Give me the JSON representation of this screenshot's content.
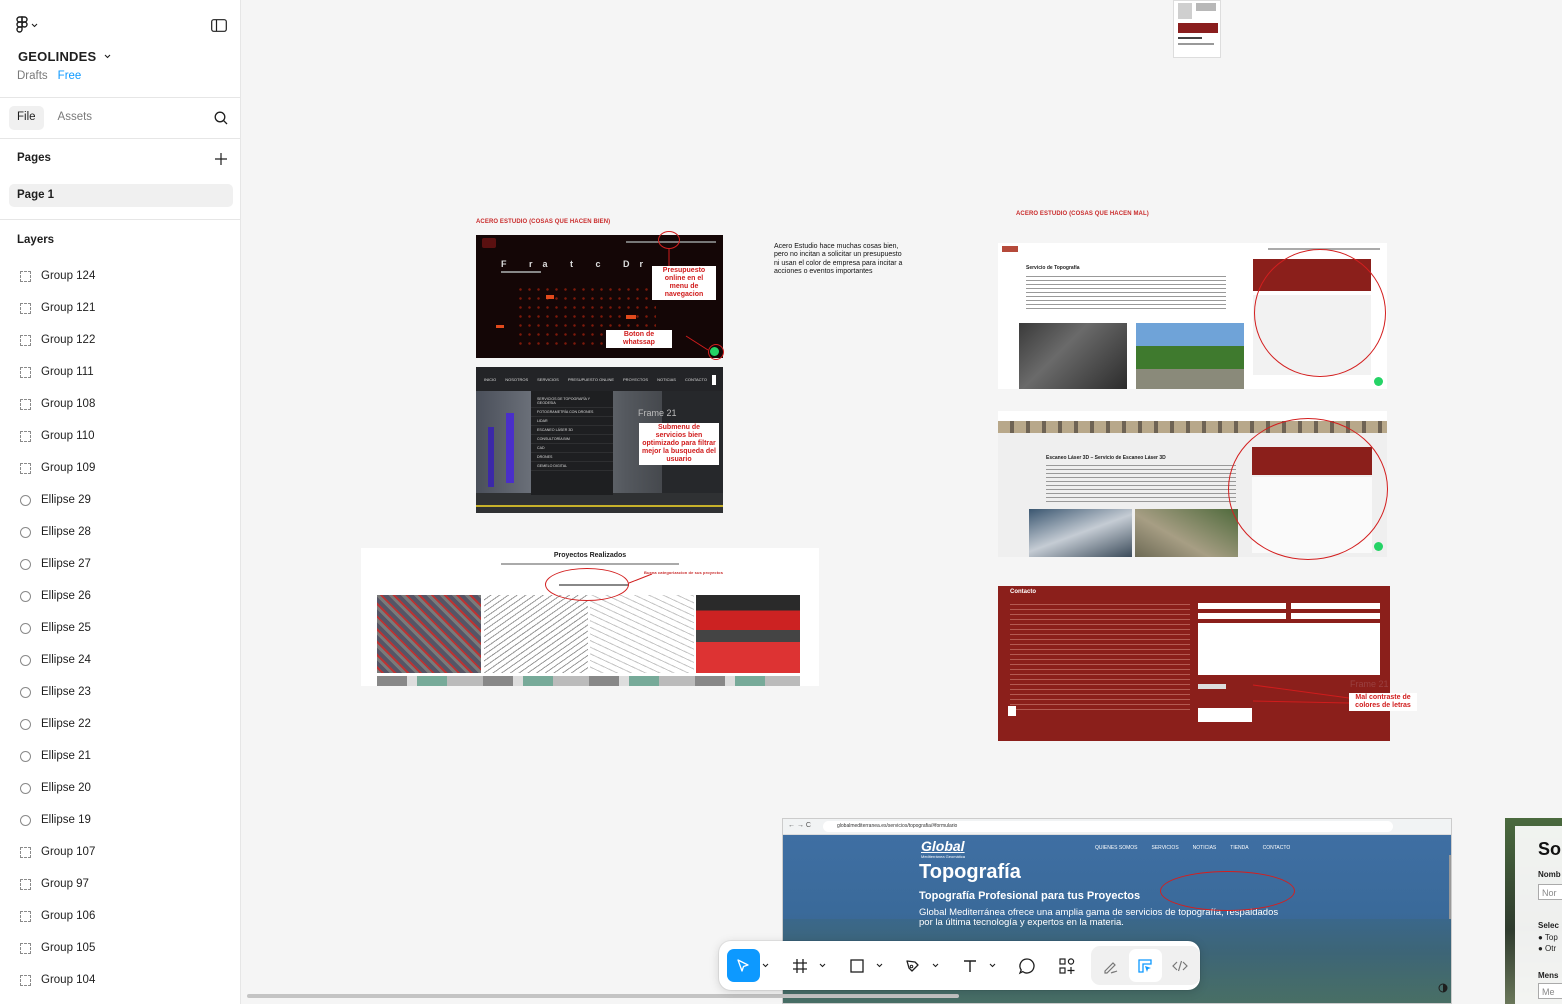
{
  "file": {
    "name": "GEOLINDES",
    "location": "Drafts",
    "plan": "Free"
  },
  "tabs": {
    "file": "File",
    "assets": "Assets"
  },
  "pages": {
    "header": "Pages",
    "items": [
      "Page 1"
    ]
  },
  "layers": {
    "header": "Layers",
    "items": [
      {
        "name": "Group 124",
        "type": "frame"
      },
      {
        "name": "Group 121",
        "type": "frame"
      },
      {
        "name": "Group 122",
        "type": "frame"
      },
      {
        "name": "Group 111",
        "type": "frame"
      },
      {
        "name": "Group 108",
        "type": "frame"
      },
      {
        "name": "Group 110",
        "type": "frame"
      },
      {
        "name": "Group 109",
        "type": "frame"
      },
      {
        "name": "Ellipse 29",
        "type": "ellipse"
      },
      {
        "name": "Ellipse 28",
        "type": "ellipse"
      },
      {
        "name": "Ellipse 27",
        "type": "ellipse"
      },
      {
        "name": "Ellipse 26",
        "type": "ellipse"
      },
      {
        "name": "Ellipse 25",
        "type": "ellipse"
      },
      {
        "name": "Ellipse 24",
        "type": "ellipse"
      },
      {
        "name": "Ellipse 23",
        "type": "ellipse"
      },
      {
        "name": "Ellipse 22",
        "type": "ellipse"
      },
      {
        "name": "Ellipse 21",
        "type": "ellipse"
      },
      {
        "name": "Ellipse 20",
        "type": "ellipse"
      },
      {
        "name": "Ellipse 19",
        "type": "ellipse"
      },
      {
        "name": "Group 107",
        "type": "frame"
      },
      {
        "name": "Group 97",
        "type": "frame"
      },
      {
        "name": "Group 106",
        "type": "frame"
      },
      {
        "name": "Group 105",
        "type": "frame"
      },
      {
        "name": "Group 104",
        "type": "frame"
      }
    ]
  },
  "canvas": {
    "label_good": "ACERO ESTUDIO (COSAS QUE HACEN BIEN)",
    "label_bad": "ACERO ESTUDIO (COSAS QUE HACEN MAL)",
    "note": "Acero Estudio hace muchas cosas bien, pero no incitan a solicitar un presupuesto ni usan el color de empresa para incitar a acciones o eventos importantes",
    "ann_presupuesto": "Presupuesto online en el menu de navegacion",
    "ann_whatsapp": "Boton de whatssap",
    "ann_submenu": "Submenu de servicios bien optimizado para filtrar mejor la busqueda del usuario",
    "ann_contraste": "Mal contraste de colores de letras",
    "frame_label": "Frame 21",
    "nav_items": [
      "INICIO",
      "NOSOTROS",
      "SERVICIOS",
      "PRESUPUESTO ONLINE",
      "PROYECTOS",
      "NOTICIAS",
      "CONTACTO"
    ],
    "submenu_items": [
      "SERVICIOS DE TOPOGRAFÍA Y GEODESIA",
      "FOTOGRAMETRÍA CON DRONES",
      "LIDAR",
      "ESCANEO LÁSER 3D",
      "CONSULTORÍA BIM",
      "CAD",
      "DRONES",
      "GEMELO DIGITAL"
    ],
    "proyectos_title": "Proyectos Realizados",
    "topografia_title": "Servicio de Topografía",
    "escaneo_title": "Escaneo Láser 3D – Servicio de Escaneo Láser 3D",
    "contacto_title": "Contacto",
    "global": {
      "url": "globalmediterranea.es/servicios/topografia/#formulario",
      "logo": "Global",
      "logo_sub": "Mediterránea Geomática",
      "nav": [
        "QUIENES SOMOS",
        "SERVICIOS",
        "NOTICIAS",
        "TIENDA",
        "CONTACTO"
      ],
      "hero_title": "Topografía",
      "hero_subtitle": "Topografía Profesional para tus Proyectos",
      "hero_text": "Global Mediterránea ofrece una amplia gama de servicios de topografía, respaldados por la última tecnología y expertos en la materia."
    },
    "right_edge": {
      "title": "So",
      "l1": "Nomb",
      "i1": "Nor",
      "l2": "Selec",
      "o1": "● Top",
      "o2": "● Otr",
      "l3": "Mens",
      "i3": "Me"
    }
  },
  "toolbar": {
    "tools": [
      "move-tool",
      "frame-tool",
      "shape-tool",
      "pen-tool",
      "text-tool",
      "comment-tool",
      "actions-tool"
    ],
    "modes": [
      "draw-mode",
      "design-mode",
      "dev-mode"
    ]
  },
  "colors": {
    "accent": "#0d99ff",
    "annotation_red": "#d01c1c",
    "contact_bg": "#8b1f1b"
  }
}
